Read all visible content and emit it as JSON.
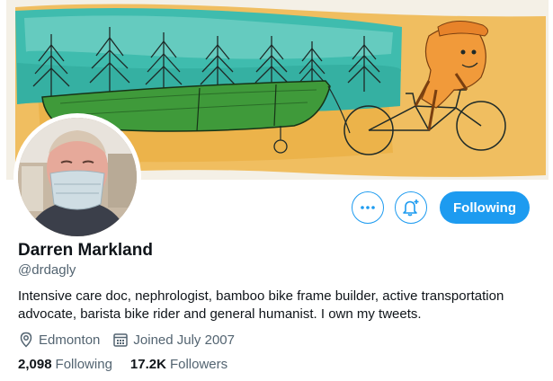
{
  "profile": {
    "name": "Darren Markland",
    "handle": "@drdagly",
    "bio": "Intensive care doc, nephrologist, bamboo bike frame builder, active transportation advocate, barista bike rider and general humanist. I own my tweets.",
    "location": "Edmonton",
    "joined": "Joined July 2007"
  },
  "stats": {
    "following_count": "2,098",
    "following_label": "Following",
    "followers_count": "17.2K",
    "followers_label": "Followers"
  },
  "actions": {
    "follow_button_label": "Following",
    "more_icon": "more-icon",
    "notify_icon": "bell-plus-icon"
  },
  "colors": {
    "accent": "#1d9bf0",
    "secondary_text": "#536471",
    "primary_text": "#0f1419"
  }
}
